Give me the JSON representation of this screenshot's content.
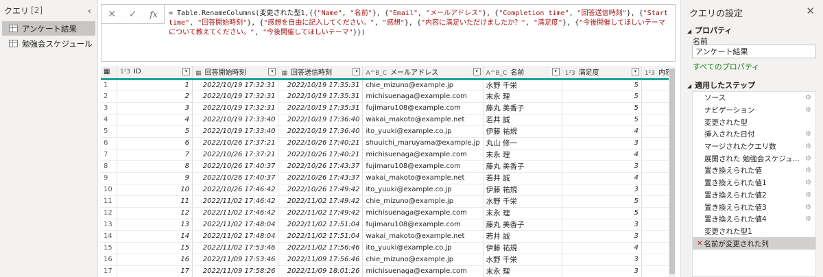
{
  "queries": {
    "title": "クエリ",
    "count": "[2]",
    "collapse": "‹",
    "items": [
      "アンケート結果",
      "勉強会スケジュール"
    ]
  },
  "formula_bar": {
    "cancel": "✕",
    "commit": "✓",
    "fx": "fx",
    "text_parts": [
      {
        "t": "= Table.RenameColumns(変更された型1,{{",
        "s": false
      },
      {
        "t": "\"Name\"",
        "s": true
      },
      {
        "t": ", ",
        "s": false
      },
      {
        "t": "\"名前\"",
        "s": true
      },
      {
        "t": "}, {",
        "s": false
      },
      {
        "t": "\"Email\"",
        "s": true
      },
      {
        "t": ", ",
        "s": false
      },
      {
        "t": "\"メールアドレス\"",
        "s": true
      },
      {
        "t": "}, {",
        "s": false
      },
      {
        "t": "\"Completion time\"",
        "s": true
      },
      {
        "t": ", ",
        "s": false
      },
      {
        "t": "\"回答送信時刻\"",
        "s": true
      },
      {
        "t": "}, {",
        "s": false
      },
      {
        "t": "\"Start time\"",
        "s": true
      },
      {
        "t": ", ",
        "s": false
      },
      {
        "t": "\"回答開始時刻\"",
        "s": true
      },
      {
        "t": "}, {",
        "s": false
      },
      {
        "t": "\"感想を自由に記入してください。\"",
        "s": true
      },
      {
        "t": ", ",
        "s": false
      },
      {
        "t": "\"感想\"",
        "s": true
      },
      {
        "t": "}, {",
        "s": false
      },
      {
        "t": "\"内容に満足いただけましたか？\"",
        "s": true
      },
      {
        "t": ", ",
        "s": false
      },
      {
        "t": "\"満足度\"",
        "s": true
      },
      {
        "t": "}, {",
        "s": false
      },
      {
        "t": "\"今後開催してほしいテーマについて教えてください。\"",
        "s": true
      },
      {
        "t": ", ",
        "s": false
      },
      {
        "t": "\"今後開催してほしいテーマ\"",
        "s": true
      },
      {
        "t": "}})",
        "s": false
      }
    ]
  },
  "grid": {
    "columns": [
      {
        "type": "1²3",
        "label": "ID"
      },
      {
        "type": "▦",
        "label": "回答開始時刻"
      },
      {
        "type": "▦",
        "label": "回答送信時刻"
      },
      {
        "type": "A^B_C",
        "label": "メールアドレス"
      },
      {
        "type": "A^B_C",
        "label": "名前"
      },
      {
        "type": "1²3",
        "label": "満足度"
      },
      {
        "type": "1²3",
        "label": "内容"
      }
    ],
    "rows": [
      [
        "1",
        "1",
        "2022/10/19 17:32:31",
        "2022/10/19 17:35:31",
        "chie_mizuno@example.jp",
        "水野 千栄",
        "5"
      ],
      [
        "2",
        "2",
        "2022/10/19 17:32:31",
        "2022/10/19 17:35:31",
        "michisuenaga@example.com",
        "末永 理",
        "5"
      ],
      [
        "3",
        "3",
        "2022/10/19 17:32:31",
        "2022/10/19 17:35:31",
        "fujimaru108@example.com",
        "藤丸 美香子",
        "5"
      ],
      [
        "4",
        "4",
        "2022/10/19 17:33:40",
        "2022/10/19 17:36:40",
        "wakai_makoto@example.net",
        "若井 誠",
        "5"
      ],
      [
        "5",
        "5",
        "2022/10/19 17:33:40",
        "2022/10/19 17:36:40",
        "ito_yuuki@example.co.jp",
        "伊藤 祐規",
        "4"
      ],
      [
        "6",
        "6",
        "2022/10/26 17:37:21",
        "2022/10/26 17:40:21",
        "shuuichi_maruyama@example.jp",
        "丸山 修一",
        "3"
      ],
      [
        "7",
        "7",
        "2022/10/26 17:37:21",
        "2022/10/26 17:40:21",
        "michisuenaga@example.com",
        "末永 理",
        "4"
      ],
      [
        "8",
        "8",
        "2022/10/26 17:40:37",
        "2022/10/26 17:43:37",
        "fujimaru108@example.com",
        "藤丸 美香子",
        "3"
      ],
      [
        "9",
        "9",
        "2022/10/26 17:40:37",
        "2022/10/26 17:43:37",
        "wakai_makoto@example.net",
        "若井 誠",
        "4"
      ],
      [
        "10",
        "10",
        "2022/10/26 17:46:42",
        "2022/10/26 17:49:42",
        "ito_yuuki@example.co.jp",
        "伊藤 祐規",
        "3"
      ],
      [
        "11",
        "11",
        "2022/11/02 17:46:42",
        "2022/11/02 17:49:42",
        "chie_mizuno@example.jp",
        "水野 千栄",
        "5"
      ],
      [
        "12",
        "12",
        "2022/11/02 17:46:42",
        "2022/11/02 17:49:42",
        "michisuenaga@example.com",
        "末永 理",
        "5"
      ],
      [
        "13",
        "13",
        "2022/11/02 17:48:04",
        "2022/11/02 17:51:04",
        "fujimaru108@example.com",
        "藤丸 美香子",
        "3"
      ],
      [
        "14",
        "14",
        "2022/11/02 17:48:04",
        "2022/11/02 17:51:04",
        "wakai_makoto@example.net",
        "若井 誠",
        "3"
      ],
      [
        "15",
        "15",
        "2022/11/02 17:53:46",
        "2022/11/02 17:56:46",
        "ito_yuuki@example.co.jp",
        "伊藤 祐規",
        "4"
      ],
      [
        "16",
        "16",
        "2022/11/09 17:53:46",
        "2022/11/09 17:56:46",
        "chie_mizuno@example.jp",
        "水野 千栄",
        "3"
      ],
      [
        "17",
        "17",
        "2022/11/09 17:58:26",
        "2022/11/09 18:01:26",
        "michisuenaga@example.com",
        "末永 理",
        "3"
      ]
    ]
  },
  "settings": {
    "title": "クエリの設定",
    "close": "✕",
    "properties_header": "プロパティ",
    "name_label": "名前",
    "name_value": "アンケート結果",
    "all_properties": "すべてのプロパティ",
    "steps_header": "適用したステップ",
    "steps": [
      {
        "label": "ソース",
        "gear": true
      },
      {
        "label": "ナビゲーション",
        "gear": true
      },
      {
        "label": "変更された型",
        "gear": false
      },
      {
        "label": "挿入された日付",
        "gear": true
      },
      {
        "label": "マージされたクエリ数",
        "gear": true
      },
      {
        "label": "展開された 勉強会スケジュ...",
        "gear": true
      },
      {
        "label": "置き換えられた値",
        "gear": true
      },
      {
        "label": "置き換えられた値1",
        "gear": true
      },
      {
        "label": "置き換えられた値2",
        "gear": true
      },
      {
        "label": "置き換えられた値3",
        "gear": true
      },
      {
        "label": "置き換えられた値4",
        "gear": true
      },
      {
        "label": "変更された型1",
        "gear": false
      },
      {
        "label": "名前が変更された列",
        "gear": false,
        "selected": true
      }
    ]
  }
}
